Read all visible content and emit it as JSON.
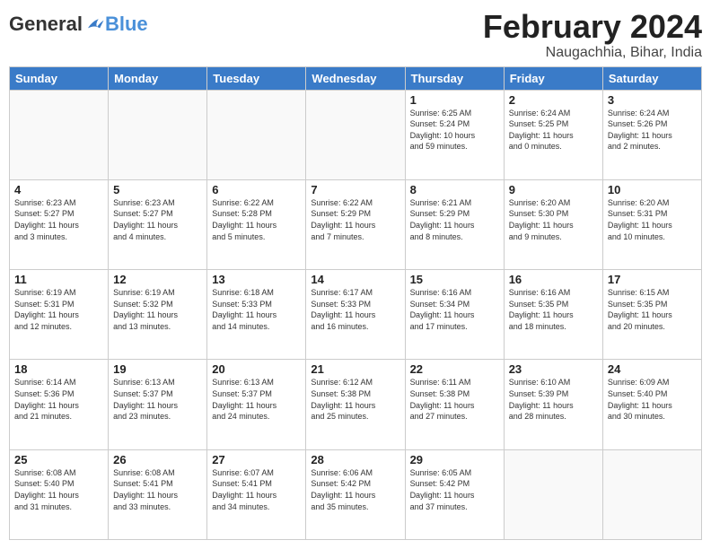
{
  "header": {
    "logo": {
      "general": "General",
      "blue": "Blue"
    },
    "title": "February 2024",
    "location": "Naugachhia, Bihar, India"
  },
  "weekdays": [
    "Sunday",
    "Monday",
    "Tuesday",
    "Wednesday",
    "Thursday",
    "Friday",
    "Saturday"
  ],
  "weeks": [
    [
      {
        "day": "",
        "info": ""
      },
      {
        "day": "",
        "info": ""
      },
      {
        "day": "",
        "info": ""
      },
      {
        "day": "",
        "info": ""
      },
      {
        "day": "1",
        "info": "Sunrise: 6:25 AM\nSunset: 5:24 PM\nDaylight: 10 hours\nand 59 minutes."
      },
      {
        "day": "2",
        "info": "Sunrise: 6:24 AM\nSunset: 5:25 PM\nDaylight: 11 hours\nand 0 minutes."
      },
      {
        "day": "3",
        "info": "Sunrise: 6:24 AM\nSunset: 5:26 PM\nDaylight: 11 hours\nand 2 minutes."
      }
    ],
    [
      {
        "day": "4",
        "info": "Sunrise: 6:23 AM\nSunset: 5:27 PM\nDaylight: 11 hours\nand 3 minutes."
      },
      {
        "day": "5",
        "info": "Sunrise: 6:23 AM\nSunset: 5:27 PM\nDaylight: 11 hours\nand 4 minutes."
      },
      {
        "day": "6",
        "info": "Sunrise: 6:22 AM\nSunset: 5:28 PM\nDaylight: 11 hours\nand 5 minutes."
      },
      {
        "day": "7",
        "info": "Sunrise: 6:22 AM\nSunset: 5:29 PM\nDaylight: 11 hours\nand 7 minutes."
      },
      {
        "day": "8",
        "info": "Sunrise: 6:21 AM\nSunset: 5:29 PM\nDaylight: 11 hours\nand 8 minutes."
      },
      {
        "day": "9",
        "info": "Sunrise: 6:20 AM\nSunset: 5:30 PM\nDaylight: 11 hours\nand 9 minutes."
      },
      {
        "day": "10",
        "info": "Sunrise: 6:20 AM\nSunset: 5:31 PM\nDaylight: 11 hours\nand 10 minutes."
      }
    ],
    [
      {
        "day": "11",
        "info": "Sunrise: 6:19 AM\nSunset: 5:31 PM\nDaylight: 11 hours\nand 12 minutes."
      },
      {
        "day": "12",
        "info": "Sunrise: 6:19 AM\nSunset: 5:32 PM\nDaylight: 11 hours\nand 13 minutes."
      },
      {
        "day": "13",
        "info": "Sunrise: 6:18 AM\nSunset: 5:33 PM\nDaylight: 11 hours\nand 14 minutes."
      },
      {
        "day": "14",
        "info": "Sunrise: 6:17 AM\nSunset: 5:33 PM\nDaylight: 11 hours\nand 16 minutes."
      },
      {
        "day": "15",
        "info": "Sunrise: 6:16 AM\nSunset: 5:34 PM\nDaylight: 11 hours\nand 17 minutes."
      },
      {
        "day": "16",
        "info": "Sunrise: 6:16 AM\nSunset: 5:35 PM\nDaylight: 11 hours\nand 18 minutes."
      },
      {
        "day": "17",
        "info": "Sunrise: 6:15 AM\nSunset: 5:35 PM\nDaylight: 11 hours\nand 20 minutes."
      }
    ],
    [
      {
        "day": "18",
        "info": "Sunrise: 6:14 AM\nSunset: 5:36 PM\nDaylight: 11 hours\nand 21 minutes."
      },
      {
        "day": "19",
        "info": "Sunrise: 6:13 AM\nSunset: 5:37 PM\nDaylight: 11 hours\nand 23 minutes."
      },
      {
        "day": "20",
        "info": "Sunrise: 6:13 AM\nSunset: 5:37 PM\nDaylight: 11 hours\nand 24 minutes."
      },
      {
        "day": "21",
        "info": "Sunrise: 6:12 AM\nSunset: 5:38 PM\nDaylight: 11 hours\nand 25 minutes."
      },
      {
        "day": "22",
        "info": "Sunrise: 6:11 AM\nSunset: 5:38 PM\nDaylight: 11 hours\nand 27 minutes."
      },
      {
        "day": "23",
        "info": "Sunrise: 6:10 AM\nSunset: 5:39 PM\nDaylight: 11 hours\nand 28 minutes."
      },
      {
        "day": "24",
        "info": "Sunrise: 6:09 AM\nSunset: 5:40 PM\nDaylight: 11 hours\nand 30 minutes."
      }
    ],
    [
      {
        "day": "25",
        "info": "Sunrise: 6:08 AM\nSunset: 5:40 PM\nDaylight: 11 hours\nand 31 minutes."
      },
      {
        "day": "26",
        "info": "Sunrise: 6:08 AM\nSunset: 5:41 PM\nDaylight: 11 hours\nand 33 minutes."
      },
      {
        "day": "27",
        "info": "Sunrise: 6:07 AM\nSunset: 5:41 PM\nDaylight: 11 hours\nand 34 minutes."
      },
      {
        "day": "28",
        "info": "Sunrise: 6:06 AM\nSunset: 5:42 PM\nDaylight: 11 hours\nand 35 minutes."
      },
      {
        "day": "29",
        "info": "Sunrise: 6:05 AM\nSunset: 5:42 PM\nDaylight: 11 hours\nand 37 minutes."
      },
      {
        "day": "",
        "info": ""
      },
      {
        "day": "",
        "info": ""
      }
    ]
  ]
}
